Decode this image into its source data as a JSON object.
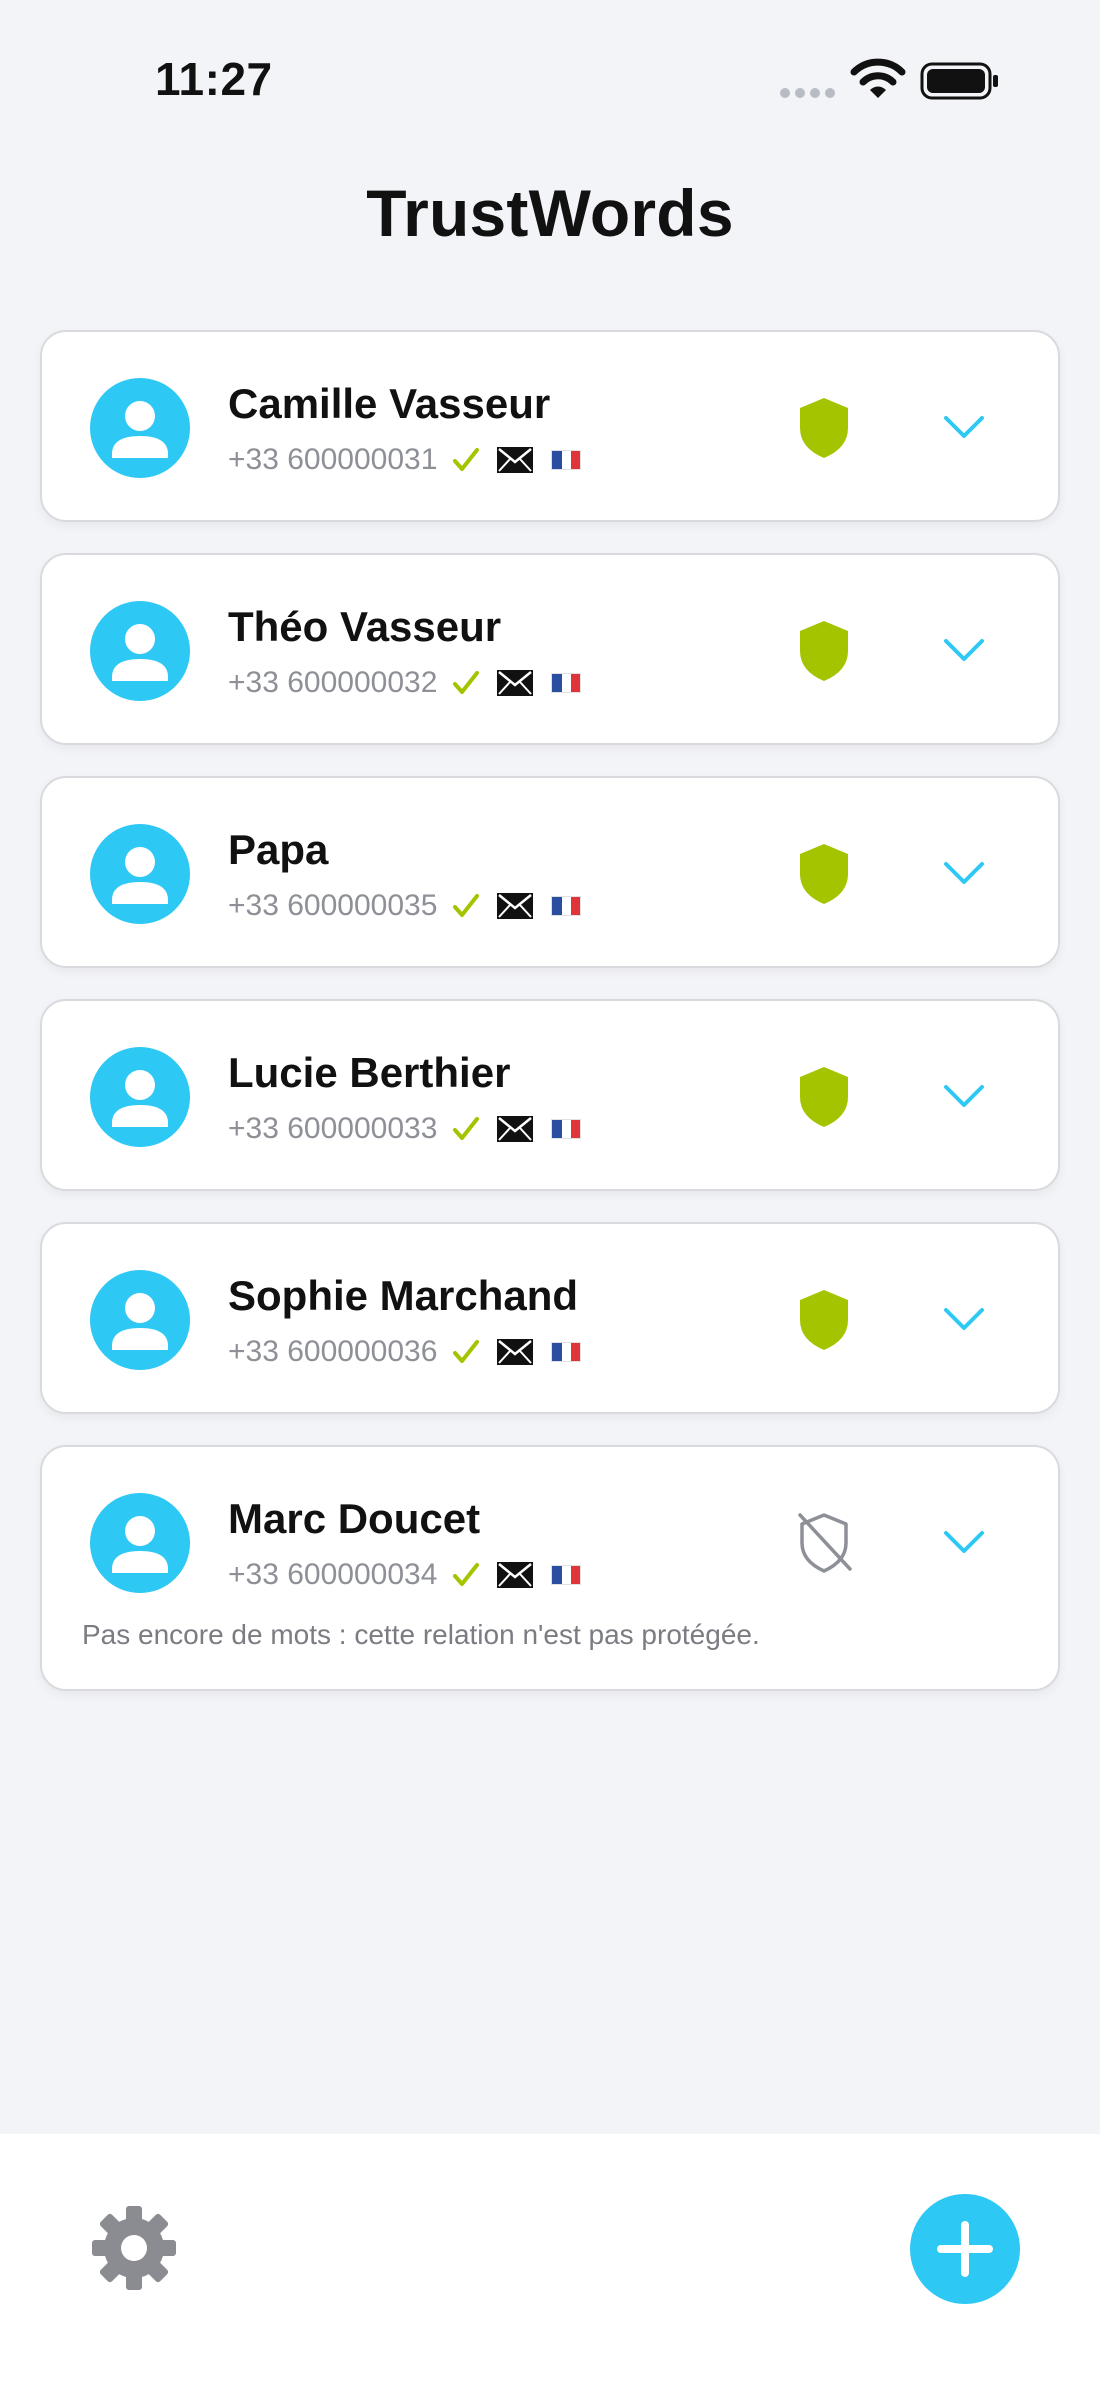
{
  "status_bar": {
    "time": "11:27"
  },
  "header": {
    "title": "TrustWords"
  },
  "colors": {
    "accent": "#2ec8f4",
    "shield_protected": "#a5c400",
    "check": "#a5c400",
    "shield_unprotected": "#8e9097"
  },
  "contacts": [
    {
      "name": "Camille Vasseur",
      "phone": "+33 600000031",
      "verified": true,
      "has_email": true,
      "flag": "fr",
      "protected": true,
      "note": ""
    },
    {
      "name": "Théo Vasseur",
      "phone": "+33 600000032",
      "verified": true,
      "has_email": true,
      "flag": "fr",
      "protected": true,
      "note": ""
    },
    {
      "name": "Papa",
      "phone": "+33 600000035",
      "verified": true,
      "has_email": true,
      "flag": "fr",
      "protected": true,
      "note": ""
    },
    {
      "name": "Lucie Berthier",
      "phone": "+33 600000033",
      "verified": true,
      "has_email": true,
      "flag": "fr",
      "protected": true,
      "note": ""
    },
    {
      "name": "Sophie Marchand",
      "phone": "+33 600000036",
      "verified": true,
      "has_email": true,
      "flag": "fr",
      "protected": true,
      "note": ""
    },
    {
      "name": "Marc Doucet",
      "phone": "+33 600000034",
      "verified": true,
      "has_email": true,
      "flag": "fr",
      "protected": false,
      "note": "Pas encore de mots : cette relation n'est pas protégée."
    }
  ],
  "bottom_bar": {
    "settings_icon": "gear-icon",
    "add_icon": "plus-icon"
  }
}
